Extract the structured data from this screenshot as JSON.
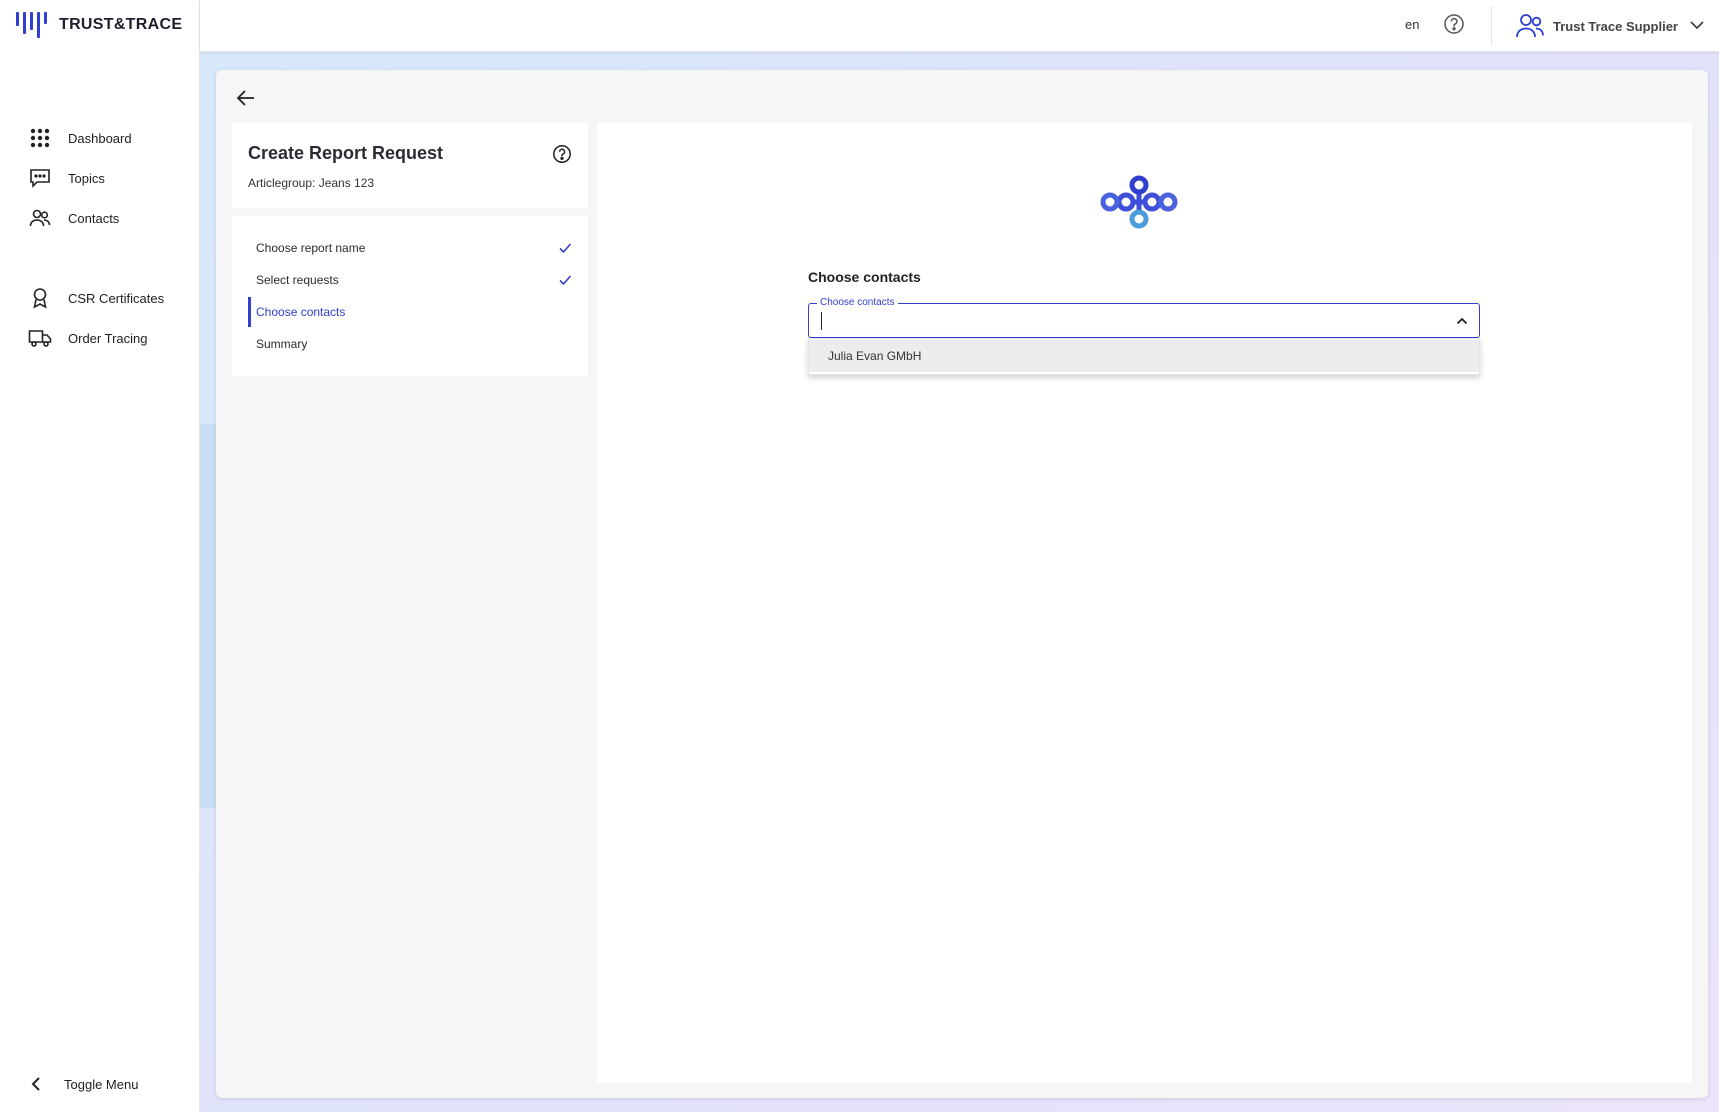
{
  "brand": {
    "name": "TRUST&TRACE",
    "color": "#2f3fd0"
  },
  "sidebar": {
    "items": [
      {
        "label": "Dashboard",
        "icon": "grid-dots-icon"
      },
      {
        "label": "Topics",
        "icon": "chat-bubble-icon"
      },
      {
        "label": "Contacts",
        "icon": "people-icon"
      },
      {
        "label": "CSR Certificates",
        "icon": "award-ribbon-icon"
      },
      {
        "label": "Order Tracing",
        "icon": "truck-icon"
      }
    ],
    "toggle_label": "Toggle Menu"
  },
  "header": {
    "language": "en",
    "user_name": "Trust Trace Supplier"
  },
  "report": {
    "title": "Create Report Request",
    "subtitle": "Articlegroup: Jeans 123"
  },
  "steps": [
    {
      "label": "Choose report name",
      "state": "done"
    },
    {
      "label": "Select requests",
      "state": "done"
    },
    {
      "label": "Choose contacts",
      "state": "active"
    },
    {
      "label": "Summary",
      "state": "pending"
    }
  ],
  "contacts": {
    "section_title": "Choose contacts",
    "field_label": "Choose contacts",
    "field_value": "",
    "options": [
      "Julia Evan GMbH"
    ]
  }
}
